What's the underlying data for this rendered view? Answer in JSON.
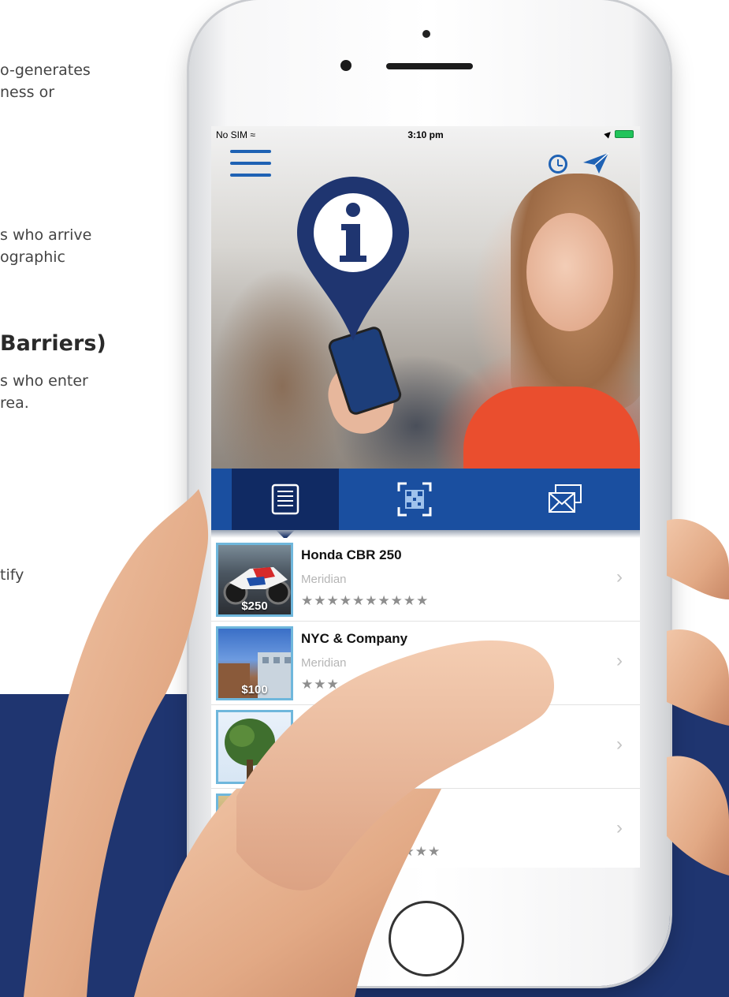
{
  "background_text": {
    "line1": "o-generates",
    "line2": "ness or",
    "line3": "s who arrive",
    "line4": "ographic",
    "heading": "Barriers)",
    "line5": "s who enter",
    "line6": "rea.",
    "line7": "tify"
  },
  "status_bar": {
    "carrier": "No SIM",
    "time": "3:10 pm"
  },
  "icons": {
    "menu": "menu-icon",
    "history": "history-icon",
    "send": "send-icon",
    "info_pin": "info-pin-icon",
    "list_tab": "list-icon",
    "qr_tab": "qr-code-icon",
    "mail_tab": "mail-icon"
  },
  "colors": {
    "accent_blue": "#1f62b4",
    "tab_bar": "#1a4fa0",
    "tab_active": "#102a63",
    "navy_band": "#1f3570",
    "pin": "#1f3570"
  },
  "list": [
    {
      "title": "Honda CBR 250",
      "subtitle": "Meridian",
      "price": "$250",
      "stars": "★★★★★★★★★★",
      "chevron": "›"
    },
    {
      "title": "NYC & Company",
      "subtitle": "Meridian",
      "price": "$100",
      "stars": "★★★",
      "chevron": "›"
    },
    {
      "title": "",
      "subtitle": "",
      "price": "",
      "stars": "",
      "chevron": "›"
    },
    {
      "title": "",
      "subtitle": "",
      "price": "",
      "stars": "★★★★★",
      "chevron": "›"
    }
  ]
}
